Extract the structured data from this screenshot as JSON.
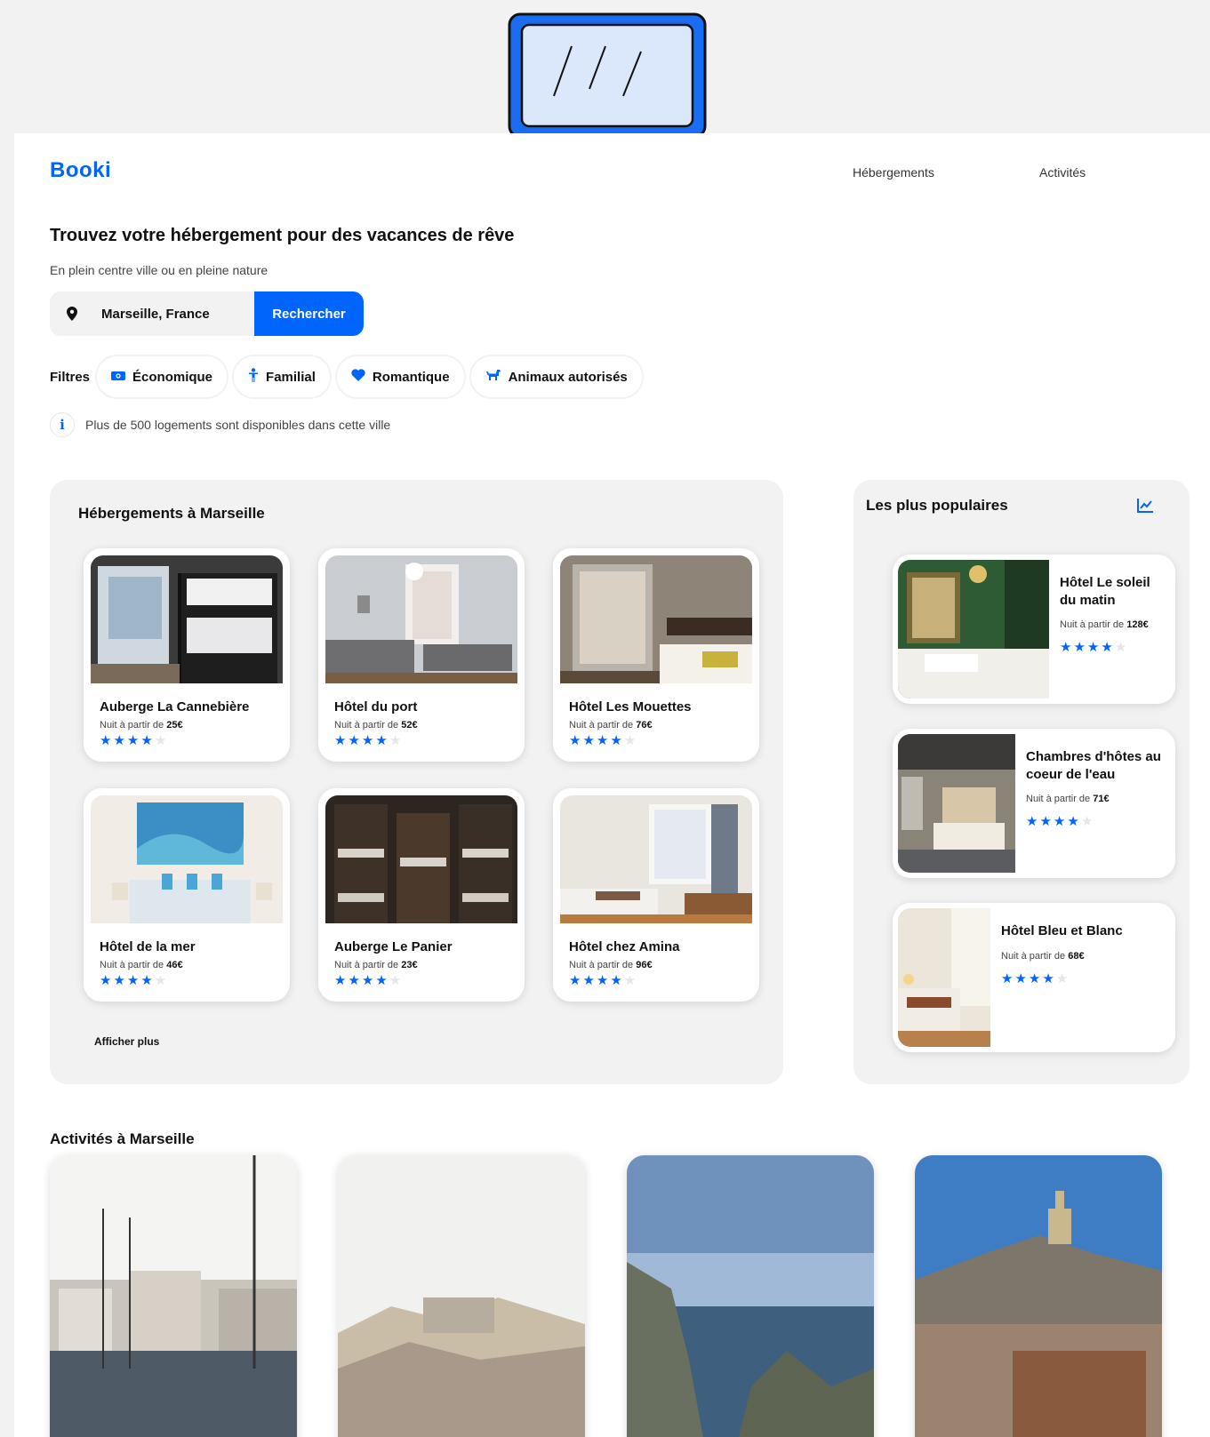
{
  "brand": {
    "logo": "Booki",
    "accent": "#0065fc"
  },
  "nav": {
    "items": [
      "Hébergements",
      "Activités"
    ]
  },
  "hero": {
    "title": "Trouvez votre hébergement pour des vacances de rêve",
    "subtitle": "En plein centre ville ou en pleine nature"
  },
  "search": {
    "value": "Marseille, France",
    "button": "Rechercher"
  },
  "filters": {
    "label": "Filtres",
    "items": [
      "Économique",
      "Familial",
      "Romantique",
      "Animaux autorisés"
    ]
  },
  "info": {
    "icon_text": "i",
    "text": "Plus de 500 logements sont disponibles dans cette ville"
  },
  "hebergements": {
    "title": "Hébergements à Marseille",
    "price_prefix": "Nuit à partir de",
    "more": "Afficher plus",
    "cards": [
      {
        "name": "Auberge La Cannebière",
        "price": "25€",
        "rating": 4
      },
      {
        "name": "Hôtel du port",
        "price": "52€",
        "rating": 4
      },
      {
        "name": "Hôtel Les Mouettes",
        "price": "76€",
        "rating": 4
      },
      {
        "name": "Hôtel de la mer",
        "price": "46€",
        "rating": 4
      },
      {
        "name": "Auberge Le Panier",
        "price": "23€",
        "rating": 4
      },
      {
        "name": "Hôtel chez Amina",
        "price": "96€",
        "rating": 4
      }
    ]
  },
  "populaires": {
    "title": "Les plus populaires",
    "price_prefix": "Nuit à partir de",
    "cards": [
      {
        "name": "Hôtel Le soleil du matin",
        "price": "128€",
        "rating": 4
      },
      {
        "name": "Chambres d'hôtes au coeur de l'eau",
        "price": "71€",
        "rating": 4
      },
      {
        "name": "Hôtel Bleu et Blanc",
        "price": "68€",
        "rating": 4
      }
    ]
  },
  "activites": {
    "title": "Activités à Marseille"
  },
  "rating_max": 5,
  "star_char": "★"
}
